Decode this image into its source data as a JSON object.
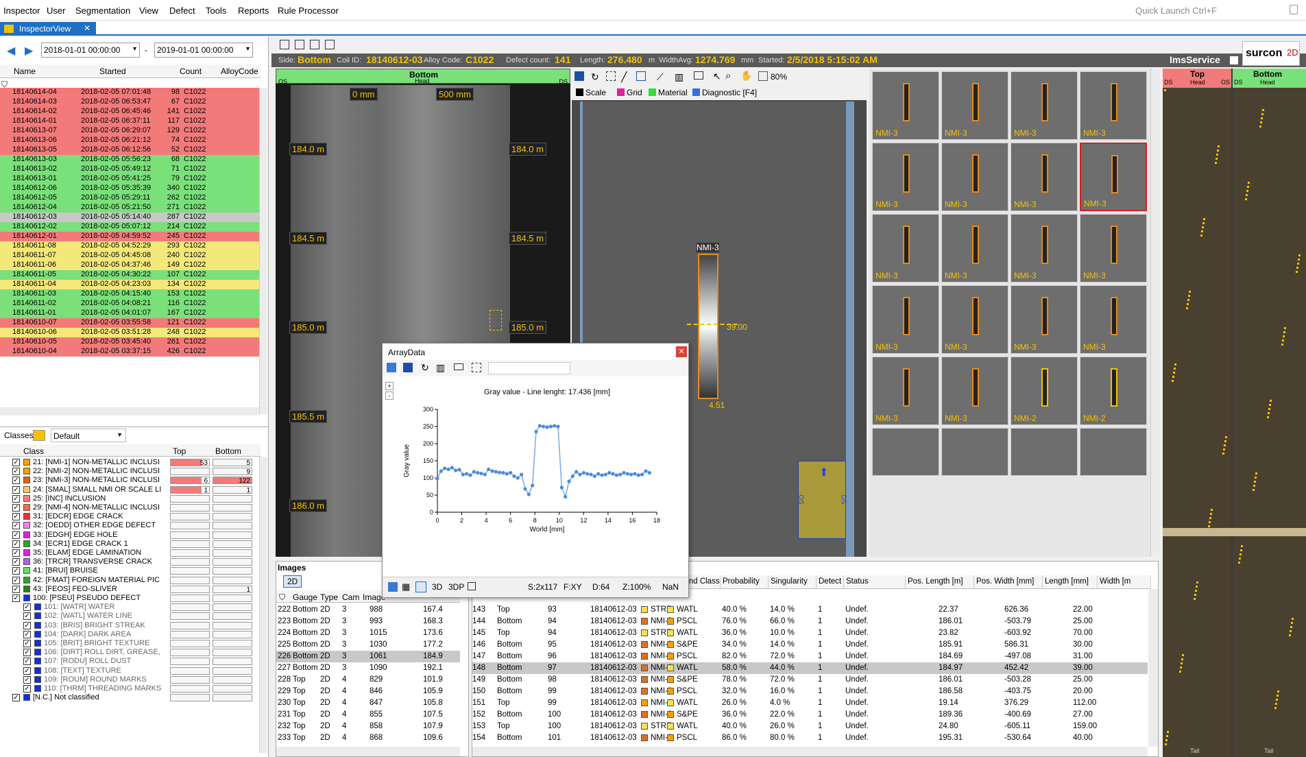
{
  "menu": {
    "items": [
      "Inspector",
      "User",
      "Segmentation",
      "View",
      "Defect",
      "Tools",
      "Reports",
      "Rule Processor"
    ],
    "quick_launch": "Quick Launch Ctrl+F"
  },
  "tab": {
    "label": "InspectorView"
  },
  "dates": {
    "from": "2018-01-01 00:00:00",
    "to": "2019-01-01 00:00:00",
    "sep": "-"
  },
  "coil_cols": [
    "Name",
    "Started",
    "Count",
    "AlloyCode"
  ],
  "coils": [
    [
      "18140614-04",
      "2018-02-05 07:01:48",
      "98",
      "C1022",
      "red"
    ],
    [
      "18140614-03",
      "2018-02-05 06:53:47",
      "67",
      "C1022",
      "red"
    ],
    [
      "18140614-02",
      "2018-02-05 06:45:46",
      "141",
      "C1022",
      "red"
    ],
    [
      "18140614-01",
      "2018-02-05 06:37:11",
      "117",
      "C1022",
      "red"
    ],
    [
      "18140613-07",
      "2018-02-05 06:29:07",
      "129",
      "C1022",
      "red"
    ],
    [
      "18140613-06",
      "2018-02-05 06:21:12",
      "74",
      "C1022",
      "red"
    ],
    [
      "18140613-05",
      "2018-02-05 06:12:56",
      "52",
      "C1022",
      "red"
    ],
    [
      "18140613-03",
      "2018-02-05 05:56:23",
      "68",
      "C1022",
      "green"
    ],
    [
      "18140613-02",
      "2018-02-05 05:49:12",
      "71",
      "C1022",
      "green"
    ],
    [
      "18140613-01",
      "2018-02-05 05:41:25",
      "79",
      "C1022",
      "green"
    ],
    [
      "18140612-06",
      "2018-02-05 05:35:39",
      "340",
      "C1022",
      "green"
    ],
    [
      "18140612-05",
      "2018-02-05 05:29:11",
      "262",
      "C1022",
      "green"
    ],
    [
      "18140612-04",
      "2018-02-05 05:21:50",
      "271",
      "C1022",
      "green"
    ],
    [
      "18140612-03",
      "2018-02-05 05:14:40",
      "287",
      "C1022",
      "grey"
    ],
    [
      "18140612-02",
      "2018-02-05 05:07:12",
      "214",
      "C1022",
      "green"
    ],
    [
      "18140612-01",
      "2018-02-05 04:59:52",
      "245",
      "C1022",
      "red"
    ],
    [
      "18140611-08",
      "2018-02-05 04:52:29",
      "293",
      "C1022",
      "yellow"
    ],
    [
      "18140611-07",
      "2018-02-05 04:45:08",
      "240",
      "C1022",
      "yellow"
    ],
    [
      "18140611-06",
      "2018-02-05 04:37:46",
      "149",
      "C1022",
      "yellow"
    ],
    [
      "18140611-05",
      "2018-02-05 04:30:22",
      "107",
      "C1022",
      "green"
    ],
    [
      "18140611-04",
      "2018-02-05 04:23:03",
      "134",
      "C1022",
      "yellow"
    ],
    [
      "18140611-03",
      "2018-02-05 04:15:40",
      "153",
      "C1022",
      "green"
    ],
    [
      "18140611-02",
      "2018-02-05 04:08:21",
      "116",
      "C1022",
      "green"
    ],
    [
      "18140611-01",
      "2018-02-05 04:01:07",
      "167",
      "C1022",
      "green"
    ],
    [
      "18140610-07",
      "2018-02-05 03:55:58",
      "121",
      "C1022",
      "red"
    ],
    [
      "18140610-06",
      "2018-02-05 03:51:28",
      "248",
      "C1022",
      "yellow"
    ],
    [
      "18140610-05",
      "2018-02-05 03:45:40",
      "261",
      "C1022",
      "red"
    ],
    [
      "18140610-04",
      "2018-02-05 03:37:15",
      "426",
      "C1022",
      "red"
    ]
  ],
  "classes_panel": {
    "label": "Classes",
    "preset": "Default",
    "col_class": "Class",
    "col_top": "Top",
    "col_bottom": "Bottom"
  },
  "classes": [
    [
      "21: [NMI-1] NON-METALLIC INCLUSI",
      "#f5a000",
      "53",
      "5"
    ],
    [
      "22: [NMI-2] NON-METALLIC INCLUSI",
      "#f5a000",
      "",
      "9"
    ],
    [
      "23: [NMI-3] NON-METALLIC INCLUSI",
      "#e06000",
      "6",
      "122"
    ],
    [
      "24: [SMAL] SMALL NMI OR SCALE LI",
      "#f8c870",
      "1",
      "1"
    ],
    [
      "25: [INC] INCLUSION",
      "#f08080",
      "",
      ""
    ],
    [
      "29: [NMI-4] NON-METALLIC INCLUSI",
      "#f07040",
      "",
      ""
    ],
    [
      "31: [EDCR] EDGE CRACK",
      "#f03030",
      "",
      ""
    ],
    [
      "32: [OEDD] OTHER EDGE DEFECT",
      "#f080f0",
      "",
      ""
    ],
    [
      "33: [EDGH] EDGE HOLE",
      "#e020e0",
      "",
      ""
    ],
    [
      "34: [ECR1] EDGE CRACK 1",
      "#30a030",
      "",
      ""
    ],
    [
      "35: [ELAM] EDGE LAMINATION",
      "#e020e0",
      "",
      ""
    ],
    [
      "36: [TRCR] TRANSVERSE CRACK",
      "#b060e0",
      "",
      ""
    ],
    [
      "41: [BRUI] BRUISE",
      "#60e060",
      "",
      ""
    ],
    [
      "42: [FMAT] FOREIGN MATERIAL PIC",
      "#30a030",
      "",
      ""
    ],
    [
      "43: [FEOS] FEO-SLIVER",
      "#208020",
      "",
      "1"
    ],
    [
      "100: [PSEU] PSEUDO DEFECT",
      "#1030e0",
      "",
      ""
    ],
    [
      "101: [WATR] WATER",
      "#1030e0",
      "",
      ""
    ],
    [
      "102: [WATL] WATER LINE",
      "#1030e0",
      "",
      ""
    ],
    [
      "103: [BRIS] BRIGHT STREAK",
      "#1030e0",
      "",
      ""
    ],
    [
      "104: [DARK] DARK AREA",
      "#1030e0",
      "",
      ""
    ],
    [
      "105: [BRIT] BRIGHT TEXTURE",
      "#1030e0",
      "",
      ""
    ],
    [
      "106: [DIRT] ROLL DIRT, GREASE,",
      "#1030e0",
      "",
      ""
    ],
    [
      "107: [RODU] ROLL DUST",
      "#1030e0",
      "",
      ""
    ],
    [
      "108: [TEXT] TEXTURE",
      "#1030e0",
      "",
      ""
    ],
    [
      "109: [ROUM] ROUND MARKS",
      "#1030e0",
      "",
      ""
    ],
    [
      "110: [THRM] THREADING MARKS",
      "#1030e0",
      "",
      ""
    ],
    [
      "[N.C.] Not classified",
      "#1030e0",
      "",
      ""
    ]
  ],
  "info": {
    "side_k": "Side:",
    "side": "Bottom",
    "coil_k": "Coil ID:",
    "coil": "18140612-03",
    "alloy_k": "Alloy Code:",
    "alloy": "C1022",
    "count_k": "Defect count:",
    "count": "141",
    "len_k": "Length:",
    "len": "276.480",
    "len_u": "m",
    "wid_k": "WidthAvg:",
    "wid": "1274.769",
    "wid_u": "mm",
    "start_k": "Started:",
    "start": "2/5/2018 5:15:02 AM",
    "ims": "ImsService",
    "logo": "surcon",
    "logo2": "2D"
  },
  "strip": {
    "title": "Bottom",
    "head": "Head",
    "os": "OS",
    "ds": "DS",
    "mm0": "0 mm",
    "mm500": "500 mm",
    "marks": [
      "184.0 m",
      "184.5 m",
      "185.0 m",
      "185.5 m",
      "186.0 m"
    ]
  },
  "defectview": {
    "zoom": "80%",
    "legend": [
      "Scale",
      "Grid",
      "Material",
      "Diagnostic [F4]"
    ],
    "label": "NMI-3",
    "length": "39.00",
    "width": "4.51",
    "os": "OS",
    "ds": "DS"
  },
  "thumbs": [
    "NMI-3",
    "NMI-3",
    "NMI-3",
    "NMI-3",
    "NMI-3",
    "NMI-3",
    "NMI-3",
    "NMI-3",
    "NMI-3",
    "NMI-3",
    "NMI-3",
    "NMI-3",
    "NMI-3",
    "NMI-3",
    "NMI-3",
    "NMI-3",
    "NMI-3",
    "NMI-3",
    "NMI-2",
    "NMI-2"
  ],
  "rightstrips": {
    "top": "Top",
    "bottom": "Bottom",
    "ds": "DS",
    "head": "Head",
    "os": "OS",
    "tail": "Tail"
  },
  "popup": {
    "title": "ArrayData",
    "chart_title": "Gray value - Line lenght: 17.436  [mm]",
    "tabs": [
      "3D",
      "3DP"
    ],
    "status": [
      "S:2x117",
      "F:XY",
      "D:64",
      "Z:100%",
      "NaN"
    ]
  },
  "chart_data": {
    "type": "line",
    "title": "Gray value - Line lenght: 17.436  [mm]",
    "xlabel": "World [mm]",
    "ylabel": "Gray value",
    "xlim": [
      0,
      18
    ],
    "ylim": [
      0,
      300
    ],
    "xticks": [
      0,
      2,
      4,
      6,
      8,
      10,
      12,
      14,
      16,
      18
    ],
    "yticks": [
      0,
      50,
      100,
      150,
      200,
      250,
      300
    ],
    "x": [
      0,
      0.3,
      0.6,
      0.9,
      1.2,
      1.5,
      1.8,
      2.1,
      2.4,
      2.7,
      3.0,
      3.3,
      3.6,
      3.9,
      4.2,
      4.5,
      4.8,
      5.1,
      5.4,
      5.7,
      6.0,
      6.3,
      6.6,
      6.9,
      7.2,
      7.5,
      7.8,
      8.1,
      8.4,
      8.7,
      9.0,
      9.3,
      9.6,
      9.9,
      10.2,
      10.5,
      10.8,
      11.1,
      11.4,
      11.7,
      12.0,
      12.3,
      12.6,
      12.9,
      13.2,
      13.5,
      13.8,
      14.1,
      14.4,
      14.7,
      15.0,
      15.3,
      15.6,
      15.9,
      16.2,
      16.5,
      16.8,
      17.1,
      17.4
    ],
    "y": [
      98,
      120,
      128,
      125,
      130,
      122,
      124,
      110,
      112,
      108,
      118,
      115,
      113,
      110,
      125,
      120,
      118,
      116,
      115,
      112,
      115,
      105,
      100,
      110,
      68,
      52,
      78,
      235,
      252,
      250,
      248,
      250,
      252,
      250,
      72,
      45,
      90,
      105,
      118,
      110,
      115,
      112,
      110,
      105,
      112,
      108,
      110,
      115,
      112,
      108,
      110,
      115,
      112,
      110,
      112,
      108,
      110,
      120,
      115
    ]
  },
  "images_panel": {
    "title": "Images",
    "tab": "2D",
    "cols": [
      "Gauge",
      "Type",
      "Cam",
      "Image",
      ""
    ],
    "rows": [
      [
        "222",
        "Bottom",
        "2D",
        "3",
        "988",
        "167.4"
      ],
      [
        "223",
        "Bottom",
        "2D",
        "3",
        "993",
        "168.3"
      ],
      [
        "224",
        "Bottom",
        "2D",
        "3",
        "1015",
        "173.6"
      ],
      [
        "225",
        "Bottom",
        "2D",
        "3",
        "1030",
        "177.2"
      ],
      [
        "226",
        "Bottom",
        "2D",
        "3",
        "1061",
        "184.9"
      ],
      [
        "227",
        "Bottom",
        "2D",
        "3",
        "1090",
        "192.1"
      ],
      [
        "228",
        "Top",
        "2D",
        "4",
        "829",
        "101.9"
      ],
      [
        "229",
        "Top",
        "2D",
        "4",
        "846",
        "105.9"
      ],
      [
        "230",
        "Top",
        "2D",
        "4",
        "847",
        "105.8"
      ],
      [
        "231",
        "Top",
        "2D",
        "4",
        "855",
        "107.5"
      ],
      [
        "232",
        "Top",
        "2D",
        "4",
        "858",
        "107.9"
      ],
      [
        "233",
        "Top",
        "2D",
        "4",
        "868",
        "109.6"
      ]
    ]
  },
  "defects_panel": {
    "cols": [
      "Online 2nd Class",
      "Probability",
      "Singularity",
      "Detect",
      "Status",
      "Pos. Length [m]",
      "Pos. Width [mm]",
      "Length [mm]",
      "Width [m"
    ],
    "rows": [
      [
        "143",
        "Top",
        "93",
        "18140612-03",
        "STRE",
        "WATL",
        "40.0 %",
        "14.0 %",
        "1",
        "Undef.",
        "22.37",
        "626.36",
        "22.00"
      ],
      [
        "144",
        "Bottom",
        "94",
        "18140612-03",
        "NMI-3",
        "PSCL",
        "76.0 %",
        "66.0 %",
        "1",
        "Undef.",
        "186.01",
        "-503.79",
        "25.00"
      ],
      [
        "145",
        "Top",
        "94",
        "18140612-03",
        "STRE",
        "WATL",
        "36.0 %",
        "10.0 %",
        "1",
        "Undef.",
        "23.82",
        "-603.92",
        "70.00"
      ],
      [
        "146",
        "Bottom",
        "95",
        "18140612-03",
        "NMI-3",
        "S&PE",
        "34.0 %",
        "14.0 %",
        "1",
        "Undef.",
        "185.91",
        "586.31",
        "30.00"
      ],
      [
        "147",
        "Bottom",
        "96",
        "18140612-03",
        "NMI-3",
        "PSCL",
        "82.0 %",
        "72.0 %",
        "1",
        "Undef.",
        "184.69",
        "-497.08",
        "31.00"
      ],
      [
        "148",
        "Bottom",
        "97",
        "18140612-03",
        "NMI-3",
        "WATL",
        "58.0 %",
        "44.0 %",
        "1",
        "Undef.",
        "184.97",
        "452.42",
        "39.00"
      ],
      [
        "149",
        "Bottom",
        "98",
        "18140612-03",
        "NMI-3",
        "S&PE",
        "78.0 %",
        "72.0 %",
        "1",
        "Undef.",
        "186.01",
        "-503.28",
        "25.00"
      ],
      [
        "150",
        "Bottom",
        "99",
        "18140612-03",
        "NMI-3",
        "PSCL",
        "32.0 %",
        "16.0 %",
        "1",
        "Undef.",
        "186.58",
        "-403.75",
        "20.00"
      ],
      [
        "151",
        "Top",
        "99",
        "18140612-03",
        "NMI-1",
        "WATL",
        "26.0 %",
        "4.0 %",
        "1",
        "Undef.",
        "19.14",
        "376.29",
        "112.00"
      ],
      [
        "152",
        "Bottom",
        "100",
        "18140612-03",
        "NMI-3",
        "S&PE",
        "36.0 %",
        "22.0 %",
        "1",
        "Undef.",
        "189.36",
        "-400.69",
        "27.00"
      ],
      [
        "153",
        "Top",
        "100",
        "18140612-03",
        "STRE",
        "WATL",
        "40.0 %",
        "26.0 %",
        "1",
        "Undef.",
        "24.80",
        "-605.11",
        "159.00"
      ],
      [
        "154",
        "Bottom",
        "101",
        "18140612-03",
        "NMI-3",
        "PSCL",
        "86.0 %",
        "80.0 %",
        "1",
        "Undef.",
        "195.31",
        "-530.64",
        "40.00"
      ]
    ]
  }
}
